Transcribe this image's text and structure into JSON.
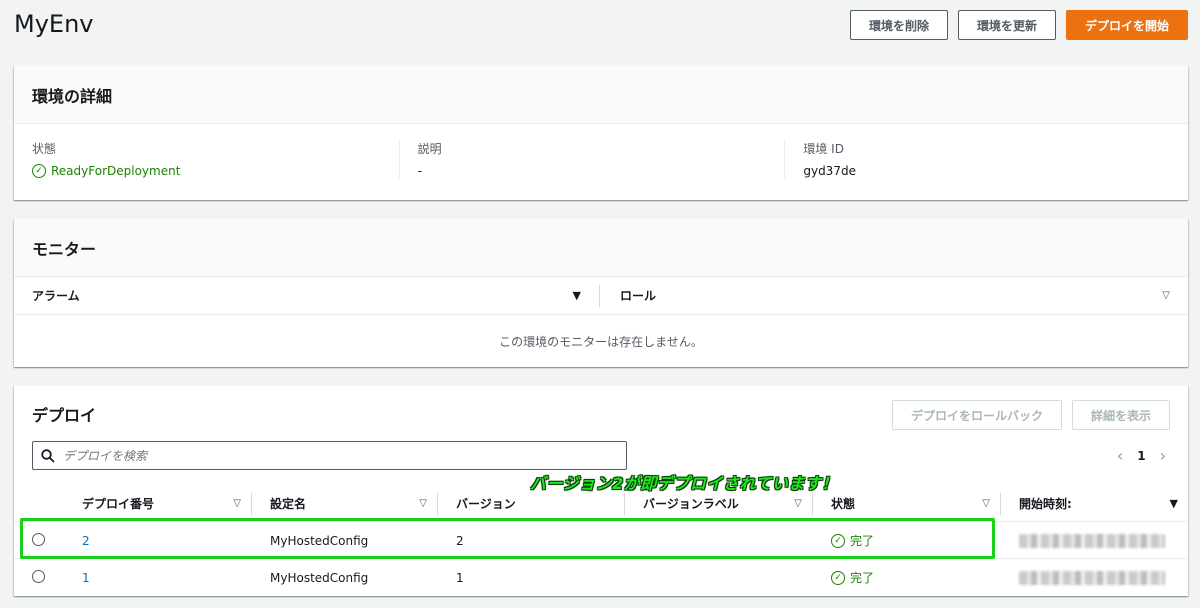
{
  "page": {
    "title": "MyEnv"
  },
  "header_actions": {
    "delete": "環境を削除",
    "update": "環境を更新",
    "start": "デプロイを開始"
  },
  "details": {
    "title": "環境の詳細",
    "state_label": "状態",
    "state_value": "ReadyForDeployment",
    "desc_label": "説明",
    "desc_value": "-",
    "id_label": "環境 ID",
    "id_value": "gyd37de"
  },
  "monitor": {
    "title": "モニター",
    "col_alarm": "アラーム",
    "col_role": "ロール",
    "empty": "この環境のモニターは存在しません。"
  },
  "deploy": {
    "title": "デプロイ",
    "rollback": "デプロイをロールバック",
    "view_details": "詳細を表示",
    "search_placeholder": "デプロイを検索",
    "page": "1",
    "columns": [
      "デプロイ番号",
      "設定名",
      "バージョン",
      "バージョンラベル",
      "状態",
      "開始時刻:"
    ],
    "rows": [
      {
        "number": "2",
        "config": "MyHostedConfig",
        "version": "2",
        "label": "",
        "status": "完了"
      },
      {
        "number": "1",
        "config": "MyHostedConfig",
        "version": "1",
        "label": "",
        "status": "完了"
      }
    ]
  },
  "annotation": {
    "text": "バージョン2が即デプロイされています！",
    "color": "#1aea1a"
  },
  "colors": {
    "primary": "#ec7211",
    "success": "#1d8102",
    "link": "#0073bb"
  }
}
